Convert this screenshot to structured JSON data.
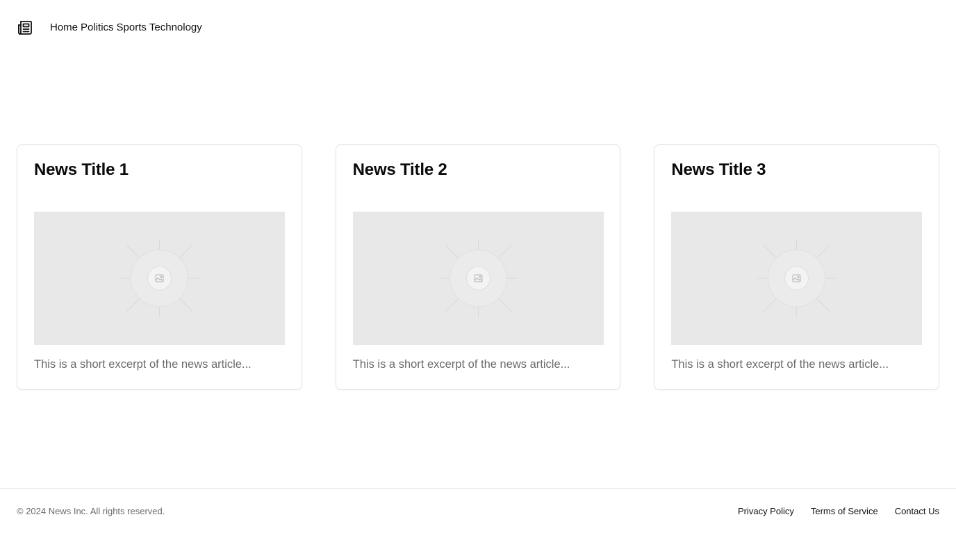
{
  "header": {
    "logo_icon": "newspaper-icon",
    "nav": [
      "Home",
      "Politics",
      "Sports",
      "Technology"
    ]
  },
  "articles": [
    {
      "title": "News Title 1",
      "image_icon": "image-placeholder-icon",
      "excerpt": "This is a short excerpt of the news article..."
    },
    {
      "title": "News Title 2",
      "image_icon": "image-placeholder-icon",
      "excerpt": "This is a short excerpt of the news article..."
    },
    {
      "title": "News Title 3",
      "image_icon": "image-placeholder-icon",
      "excerpt": "This is a short excerpt of the news article..."
    }
  ],
  "footer": {
    "copyright": "© 2024 News Inc. All rights reserved.",
    "links": [
      "Privacy Policy",
      "Terms of Service",
      "Contact Us"
    ]
  }
}
